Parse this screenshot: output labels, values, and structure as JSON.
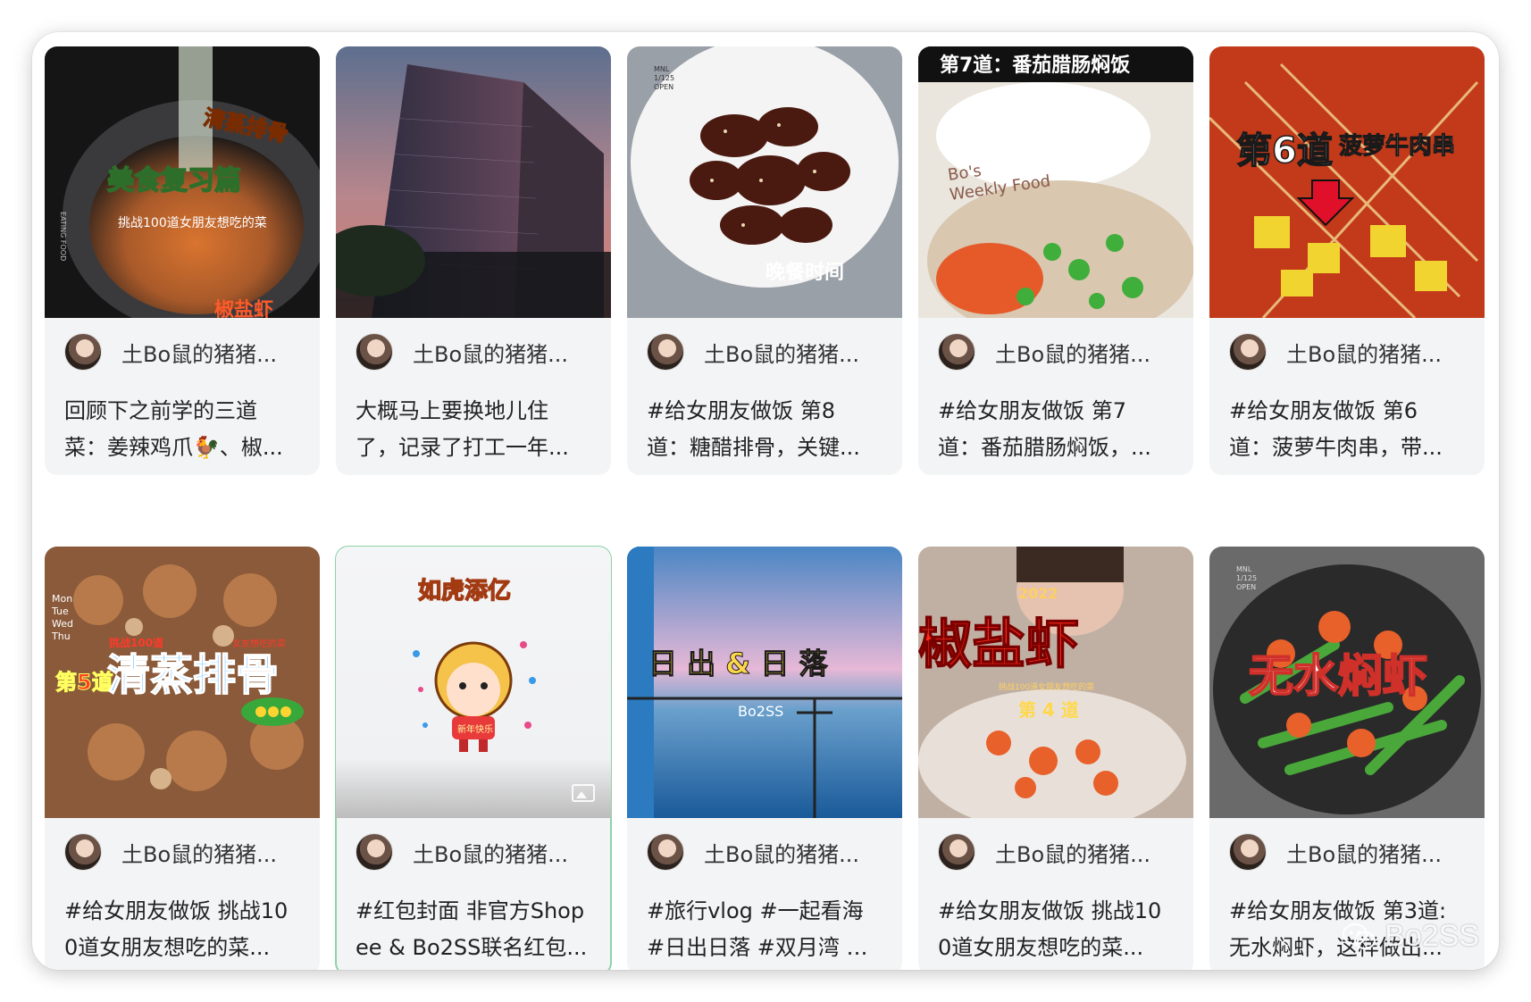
{
  "author": "土Bo鼠的猪猪...",
  "posts": [
    {
      "desc_line1": "回顾下之前学的三道",
      "desc_line2": "菜：姜辣鸡爪🐓、椒...",
      "overlay": [
        "美食复习篇",
        "清蒸排骨",
        "挑战100道女朋友想吃的菜",
        "EATING FOOD",
        "椒盐虾"
      ]
    },
    {
      "desc_line1": "大概马上要换地儿住",
      "desc_line2": "了，记录了打工一年...",
      "overlay": []
    },
    {
      "desc_line1": "#给女朋友做饭 第8",
      "desc_line2": "道：糖醋排骨，关键...",
      "overlay": [
        "晚餐时间",
        "MNL",
        "1/125",
        "OPEN"
      ]
    },
    {
      "desc_line1": "#给女朋友做饭 第7",
      "desc_line2": "道：番茄腊肠焖饭，...",
      "overlay": [
        "第7道：番茄腊肠焖饭",
        "Bo's",
        "Weekly Food"
      ]
    },
    {
      "desc_line1": "#给女朋友做饭 第6",
      "desc_line2": "道：菠萝牛肉串，带...",
      "overlay": [
        "第6道",
        "菠萝牛肉串"
      ]
    },
    {
      "desc_line1": "#给女朋友做饭 挑战10",
      "desc_line2": "0道女朋友想吃的菜...",
      "overlay": [
        "第5道",
        "清蒸排骨",
        "挑战100道",
        "女友想吃的菜",
        "Mon",
        "Tue",
        "Wed",
        "Thu"
      ]
    },
    {
      "desc_line1": "#红包封面 非官方Shop",
      "desc_line2": "ee & Bo2SS联名红包...",
      "overlay": [
        "如虎添亿",
        "新年快乐"
      ]
    },
    {
      "desc_line1": "#旅行vlog #一起看海",
      "desc_line2": "#日出日落 #双月湾 #...",
      "overlay": [
        "日 出  &  日 落",
        "Bo2SS"
      ]
    },
    {
      "desc_line1": "#给女朋友做饭 挑战10",
      "desc_line2": "0道女朋友想吃的菜...",
      "overlay": [
        "椒盐虾",
        "2022",
        "第 4 道",
        "挑战100道女朋友想吃的菜"
      ]
    },
    {
      "desc_line1": "#给女朋友做饭 第3道:",
      "desc_line2": "无水焖虾，这样做出...",
      "overlay": [
        "无水焖虾",
        "MNL",
        "1/125",
        "OPEN"
      ]
    }
  ],
  "watermark": "Bo2SS"
}
